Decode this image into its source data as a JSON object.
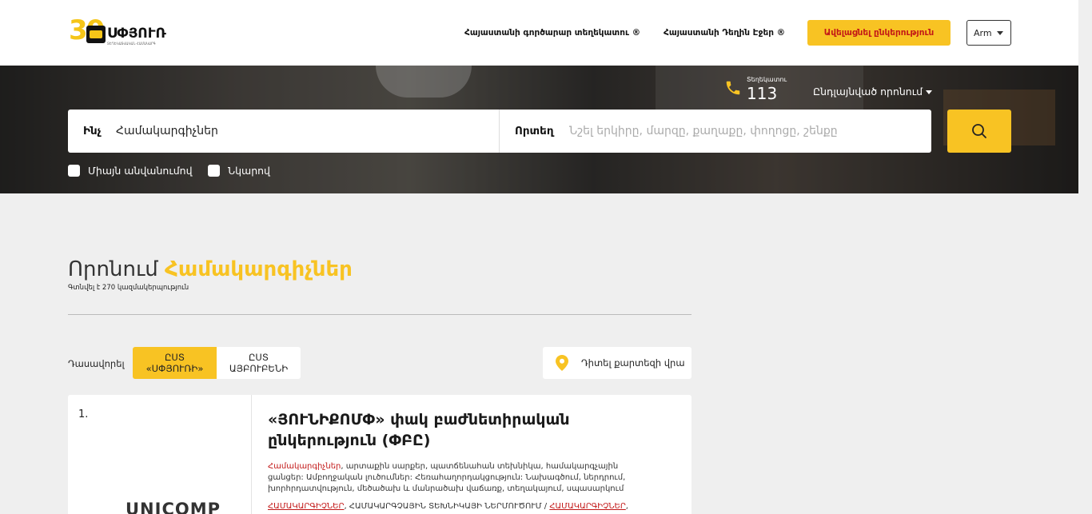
{
  "header": {
    "logo": {
      "number": "30",
      "brand": "ՍՓՅՈՒՌ",
      "tagline": "ՏԵՂԵԿԱՏՎԱԿԱՆ ՀԱՄԱԿԱՐԳ"
    },
    "nav": [
      {
        "label": "Հայաստանի գործարար տեղեկատու ®"
      },
      {
        "label": "Հայաստանի Դեղին Էջեր ®"
      }
    ],
    "add_company_label": "Ավելացնել ընկերություն",
    "language": "Arm"
  },
  "hero": {
    "reference_label": "Տեղեկատու",
    "reference_number": "113",
    "advanced_search": "Ընդլայնված որոնում",
    "what_label": "Ինչ",
    "what_value": "Համակարգիչներ",
    "where_label": "Որտեղ",
    "where_placeholder": "Նշել երկիրը, մարզը, քաղաքը, փողոցը, շենքը",
    "filters": [
      {
        "label": "Միայն անվանումով"
      },
      {
        "label": "Նկարով"
      }
    ]
  },
  "results": {
    "prefix": "Որոնում",
    "query": "Համակարգիչներ",
    "count_text": "Գտնվել է 270 կազմակերպություն",
    "sort_label": "Դասավորել",
    "sort_options": [
      {
        "line1": "ԸՍՏ",
        "line2": "«ՍՓՅՈՒՌԻ»"
      },
      {
        "line1": "ԸՍՏ",
        "line2": "ԱՅԲՈՒԲԵՆԻ"
      }
    ],
    "map_label": "Դիտել քարտեզի վրա",
    "cards": [
      {
        "index": "1.",
        "logo_text": "UNICOMP",
        "name": "«ՅՈՒՆԻՔՈՄՓ» փակ բաժնետիրական ընկերություն (ՓԲԸ)",
        "desc_keyword": "Համակարգիչներ",
        "desc_rest": ", արտաքին սարքեր, պատճենահան տեխնիկա, համակարգչային ցանցեր: Ամբողջական լուծումներ: Հեռահաղորդակցություն: Նախագծում, ներդրում, խորհրդատվություն, մեծածախ և մանրածախ վաճառք, տեղակայում, սպասարկում",
        "cat_keyword1": "ՀԱՄԱԿԱՐԳԻՉՆԵՐ",
        "cat_middle": ", ՀԱՄԱԿԱՐԳՉԱՅԻՆ ՏԵԽՆԻԿԱՅԻ ՆԵՐՄՈՒԾՈՒՄ / ",
        "cat_keyword2": "ՀԱՄԱԿԱՐԳԻՉՆԵՐ",
        "cat_end": ","
      }
    ]
  },
  "colors": {
    "accent": "#f8c323",
    "keyword": "#c21717"
  }
}
